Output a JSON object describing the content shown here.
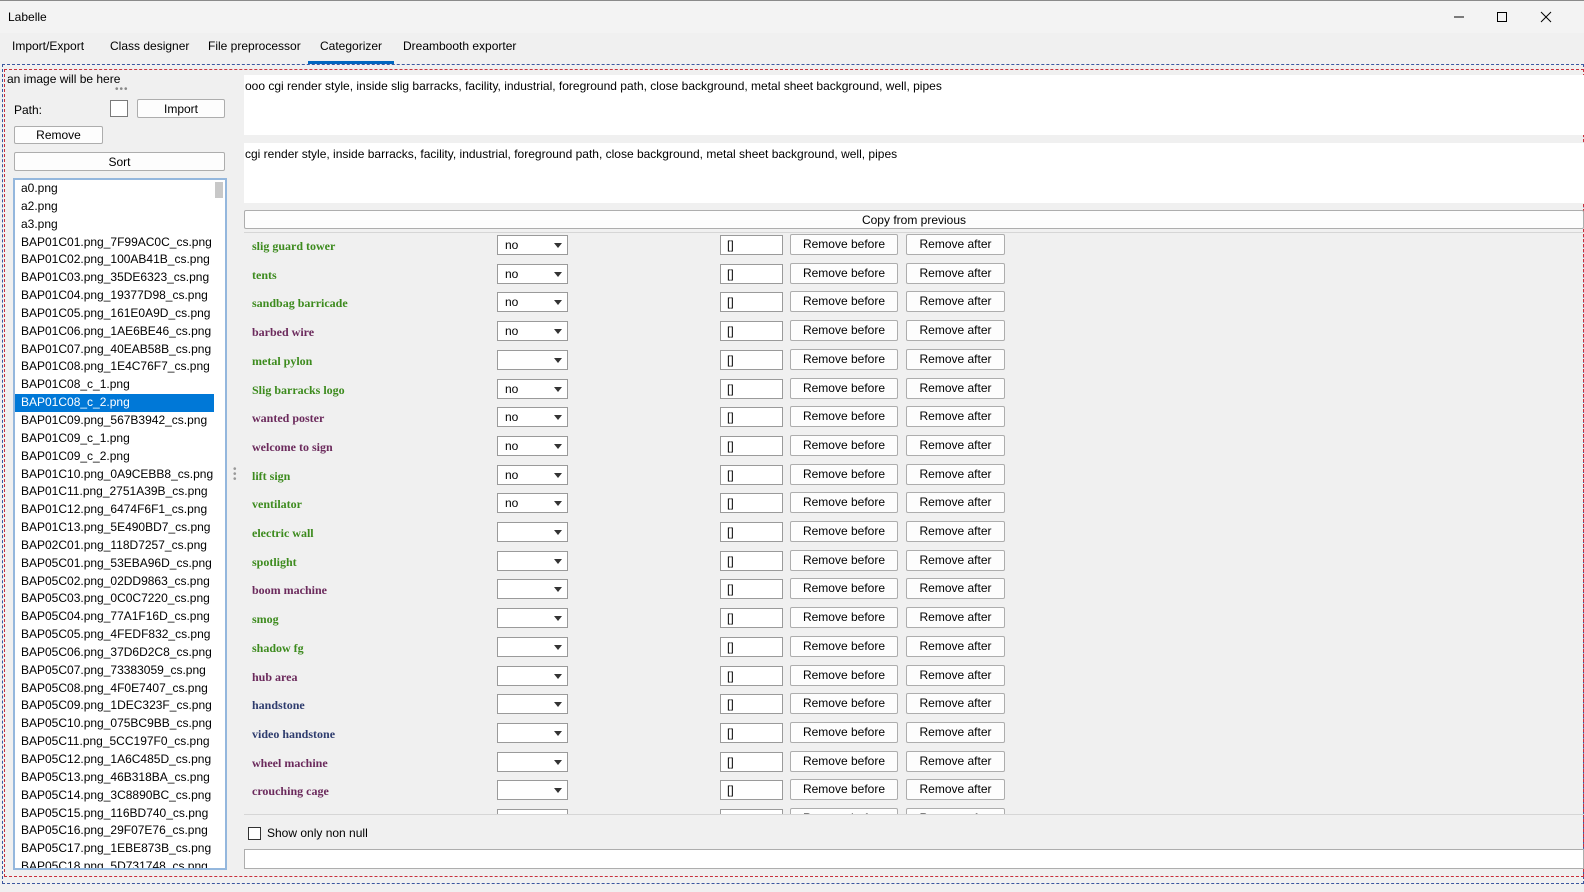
{
  "window": {
    "title": "Labelle",
    "minimize_icon": "minimize-icon",
    "maximize_icon": "maximize-icon",
    "close_icon": "close-icon"
  },
  "tabs": [
    {
      "label": "Import/Export"
    },
    {
      "label": "Class designer"
    },
    {
      "label": "File preprocessor"
    },
    {
      "label": "Categorizer",
      "active": true
    },
    {
      "label": "Dreambooth exporter"
    }
  ],
  "left": {
    "image_placeholder": "an image will be here",
    "path_label": "Path:",
    "path_value": "",
    "import_label": "Import",
    "remove_label": "Remove",
    "sort_label": "Sort",
    "files": [
      "a0.png",
      "a2.png",
      "a3.png",
      "BAP01C01.png_7F99AC0C_cs.png",
      "BAP01C02.png_100AB41B_cs.png",
      "BAP01C03.png_35DE6323_cs.png",
      "BAP01C04.png_19377D98_cs.png",
      "BAP01C05.png_161E0A9D_cs.png",
      "BAP01C06.png_1AE6BE46_cs.png",
      "BAP01C07.png_40EAB58B_cs.png",
      "BAP01C08.png_1E4C76F7_cs.png",
      "BAP01C08_c_1.png",
      "BAP01C08_c_2.png",
      "BAP01C09.png_567B3942_cs.png",
      "BAP01C09_c_1.png",
      "BAP01C09_c_2.png",
      "BAP01C10.png_0A9CEBB8_cs.png",
      "BAP01C11.png_2751A39B_cs.png",
      "BAP01C12.png_6474F6F1_cs.png",
      "BAP01C13.png_5E490BD7_cs.png",
      "BAP02C01.png_118D7257_cs.png",
      "BAP05C01.png_53EBA96D_cs.png",
      "BAP05C02.png_02DD9863_cs.png",
      "BAP05C03.png_0C0C7220_cs.png",
      "BAP05C04.png_77A1F16D_cs.png",
      "BAP05C05.png_4FEDF832_cs.png",
      "BAP05C06.png_37D6D2C8_cs.png",
      "BAP05C07.png_73383059_cs.png",
      "BAP05C08.png_4F0E7407_cs.png",
      "BAP05C09.png_1DEC323F_cs.png",
      "BAP05C10.png_075BC9BB_cs.png",
      "BAP05C11.png_5CC197F0_cs.png",
      "BAP05C12.png_1A6C485D_cs.png",
      "BAP05C13.png_46B318BA_cs.png",
      "BAP05C14.png_3C8890BC_cs.png",
      "BAP05C15.png_116BD740_cs.png",
      "BAP05C16.png_29F07E76_cs.png",
      "BAP05C17.png_1EBE873B_cs.png",
      "BAP05C18.png_5D731748_cs.png"
    ],
    "selected_index": 12
  },
  "right": {
    "caption_top": "ooo cgi render style, inside slig barracks, facility, industrial, foreground path, close background, metal sheet background, well, pipes",
    "caption_bottom": "cgi render style, inside barracks, facility, industrial, foreground path, close background, metal sheet background, well, pipes",
    "copy_label": "Copy from previous",
    "remove_before_label": "Remove before",
    "remove_after_label": "Remove after",
    "show_only_non_null_label": "Show only non null",
    "bottom_value": "",
    "colors": {
      "green": "#3d8b1e",
      "purple": "#6b2a5c",
      "navy": "#2e3c6e"
    },
    "categories": [
      {
        "name": "slig guard tower",
        "value": "no",
        "field": "[]",
        "color": "green"
      },
      {
        "name": "tents",
        "value": "no",
        "field": "[]",
        "color": "green"
      },
      {
        "name": "sandbag barricade",
        "value": "no",
        "field": "[]",
        "color": "green"
      },
      {
        "name": "barbed wire",
        "value": "no",
        "field": "[]",
        "color": "purple"
      },
      {
        "name": "metal pylon",
        "value": "",
        "field": "[]",
        "color": "green"
      },
      {
        "name": "Slig barracks logo",
        "value": "no",
        "field": "[]",
        "color": "green"
      },
      {
        "name": "wanted poster",
        "value": "no",
        "field": "[]",
        "color": "purple"
      },
      {
        "name": "welcome to sign",
        "value": "no",
        "field": "[]",
        "color": "purple"
      },
      {
        "name": "lift sign",
        "value": "no",
        "field": "[]",
        "color": "green"
      },
      {
        "name": "ventilator",
        "value": "no",
        "field": "[]",
        "color": "green"
      },
      {
        "name": "electric wall",
        "value": "",
        "field": "[]",
        "color": "green"
      },
      {
        "name": "spotlight",
        "value": "",
        "field": "[]",
        "color": "green"
      },
      {
        "name": "boom machine",
        "value": "",
        "field": "[]",
        "color": "purple"
      },
      {
        "name": "smog",
        "value": "",
        "field": "[]",
        "color": "green"
      },
      {
        "name": "shadow fg",
        "value": "",
        "field": "[]",
        "color": "green"
      },
      {
        "name": "hub area",
        "value": "",
        "field": "[]",
        "color": "purple"
      },
      {
        "name": "handstone",
        "value": "",
        "field": "[]",
        "color": "navy"
      },
      {
        "name": "video handstone",
        "value": "",
        "field": "[]",
        "color": "navy"
      },
      {
        "name": "wheel machine",
        "value": "",
        "field": "[]",
        "color": "purple"
      },
      {
        "name": "crouching cage",
        "value": "",
        "field": "[]",
        "color": "purple"
      },
      {
        "name": "",
        "value": "",
        "field": "[]",
        "color": "navy"
      }
    ]
  }
}
